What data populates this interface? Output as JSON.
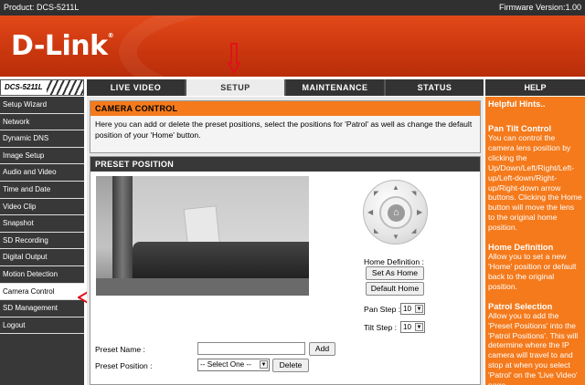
{
  "header": {
    "product": "Product: DCS-5211L",
    "firmware": "Firmware Version:1.00",
    "logo": "D-Link"
  },
  "nav": {
    "model": "DCS-5211L",
    "tabs": [
      {
        "label": "LIVE VIDEO"
      },
      {
        "label": "SETUP"
      },
      {
        "label": "MAINTENANCE"
      },
      {
        "label": "STATUS"
      }
    ],
    "active_tab": "SETUP",
    "help": "HELP"
  },
  "sidebar": {
    "items": [
      {
        "label": "Setup Wizard"
      },
      {
        "label": "Network"
      },
      {
        "label": "Dynamic DNS"
      },
      {
        "label": "Image Setup"
      },
      {
        "label": "Audio and Video"
      },
      {
        "label": "Time and Date"
      },
      {
        "label": "Video Clip"
      },
      {
        "label": "Snapshot"
      },
      {
        "label": "SD Recording"
      },
      {
        "label": "Digital Output"
      },
      {
        "label": "Motion Detection"
      },
      {
        "label": "Camera Control"
      },
      {
        "label": "SD Management"
      },
      {
        "label": "Logout"
      }
    ],
    "active_item": "Camera Control"
  },
  "camera_control": {
    "title": "CAMERA CONTROL",
    "description": "Here you can add or delete the preset positions, select the positions for 'Patrol' as well as change the default position of your 'Home' button."
  },
  "preset": {
    "title": "PRESET POSITION",
    "home_definition_label": "Home Definition :",
    "set_as_home": "Set As Home",
    "default_home": "Default Home",
    "pan_step_label": "Pan Step :",
    "pan_step_value": "10",
    "tilt_step_label": "Tilt Step :",
    "tilt_step_value": "10",
    "preset_name_label": "Preset Name :",
    "preset_name_value": "",
    "add_button": "Add",
    "preset_position_label": "Preset Position :",
    "preset_position_value": "-- Select One --",
    "delete_button": "Delete"
  },
  "help": {
    "title": "Helpful Hints..",
    "sections": [
      {
        "heading": "Pan Tilt Control",
        "text": "You can control the camera lens position by clicking the Up/Down/Left/Right/Left-up/Left-down/Right-up/Right-down arrow buttons. Clicking the Home button will move the lens to the original home position."
      },
      {
        "heading": "Home Definition",
        "text": "Allow you to set a new 'Home' position or default back to the original position."
      },
      {
        "heading": "Patrol Selection",
        "text": "Allow you to add the 'Preset Positions' into the 'Patrol Positions'. This will determine where the IP camera will travel to and stop at when you select 'Patrol' on the 'Live Video' page."
      }
    ]
  },
  "colors": {
    "orange": "#f47a1c",
    "dark": "#383838",
    "red_arrow": "#e0121a"
  }
}
